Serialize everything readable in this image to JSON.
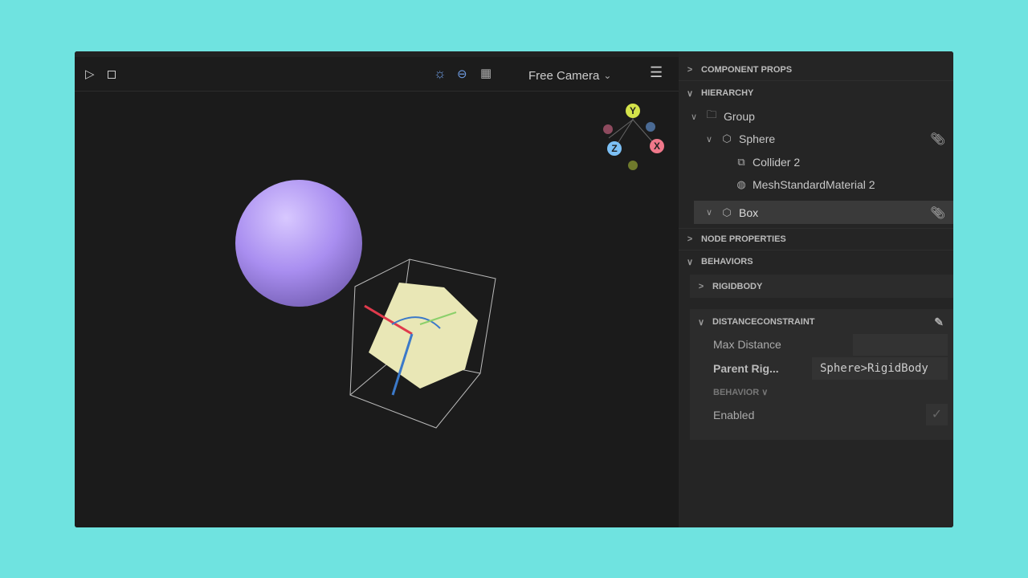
{
  "toolbar": {
    "camera": "Free Camera",
    "camera_chevron": "⌄"
  },
  "gizmo": {
    "y": "Y",
    "x": "X",
    "z": "Z"
  },
  "panel": {
    "component_props": "COMPONENT PROPS",
    "hierarchy": "HIERARCHY",
    "tree": [
      {
        "label": "Group"
      },
      {
        "label": "Sphere"
      },
      {
        "label": "Collider 2"
      },
      {
        "label": "MeshStandardMaterial 2"
      },
      {
        "label": "Box"
      }
    ],
    "node_properties": "NODE PROPERTIES",
    "behaviors": "BEHAVIORS",
    "rigidbody": "RIGIDBODY",
    "distance_constraint": "DISTANCECONSTRAINT",
    "max_distance_label": "Max Distance",
    "max_distance_value": "",
    "parent_rig_label": "Parent Rig...",
    "parent_rig_value": "Sphere>RigidBody",
    "behavior_label": "BEHAVIOR",
    "enabled_label": "Enabled",
    "enabled_check": "✓"
  }
}
